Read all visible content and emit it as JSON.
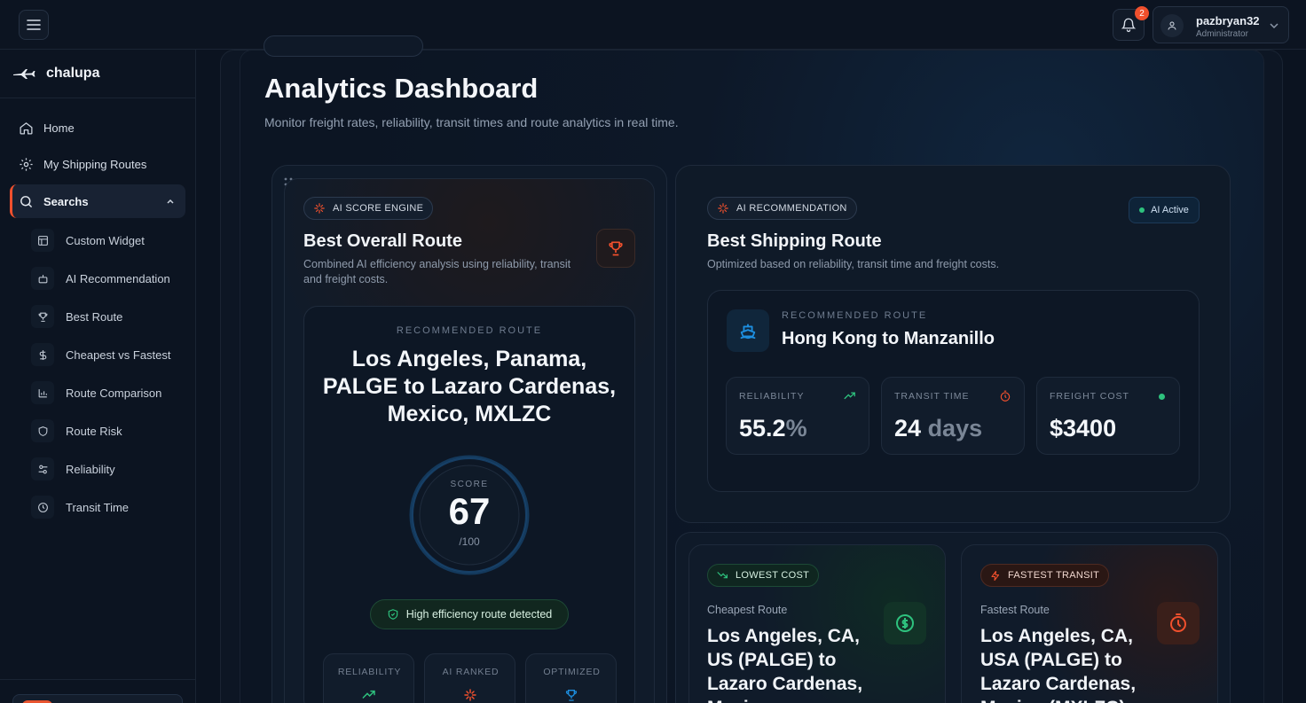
{
  "user": {
    "name": "pazbryan32",
    "role": "Administrator",
    "notifications": "2"
  },
  "brand": {
    "name": "chalupa"
  },
  "nav": {
    "home": "Home",
    "my_routes": "My Shipping Routes",
    "searchs": "Searchs",
    "sub": [
      "Custom Widget",
      "AI Recommendation",
      "Best Route",
      "Cheapest vs Fastest",
      "Route Comparison",
      "Route Risk",
      "Reliability",
      "Transit Time"
    ]
  },
  "page": {
    "title": "Analytics Dashboard",
    "subtitle": "Monitor freight rates, reliability, transit times and route analytics in real time."
  },
  "best_overall": {
    "tag": "AI SCORE ENGINE",
    "title": "Best Overall Route",
    "desc": "Combined AI efficiency analysis using reliability, transit and freight costs.",
    "rec_label": "RECOMMENDED ROUTE",
    "route": "Los Angeles, Panama, PALGE to Lazaro Cardenas, Mexico, MXLZC",
    "score_label": "SCORE",
    "score": 67,
    "score_max_label": "/100",
    "efficiency": "High efficiency route detected",
    "mini": [
      "RELIABILITY",
      "AI RANKED",
      "OPTIMIZED"
    ]
  },
  "best_shipping": {
    "tag": "AI RECOMMENDATION",
    "status": "AI Active",
    "title": "Best Shipping Route",
    "desc": "Optimized based on reliability, transit time and freight costs.",
    "rec_label": "RECOMMENDED ROUTE",
    "route": "Hong Kong to Manzanillo",
    "reliability_label": "RELIABILITY",
    "reliability_value": "55.2",
    "reliability_unit": "%",
    "transit_label": "TRANSIT TIME",
    "transit_value": "24",
    "transit_unit": "days",
    "cost_label": "FREIGHT COST",
    "cost_value": "$3400"
  },
  "cheapest": {
    "tag": "LOWEST COST",
    "sub": "Cheapest Route",
    "route": "Los Angeles, CA, US (PALGE) to Lazaro Cardenas, Mexico"
  },
  "fastest": {
    "tag": "FASTEST TRANSIT",
    "sub": "Fastest Route",
    "route": "Los Angeles, CA, USA (PALGE) to Lazaro Cardenas, Mexico (MXLZC)"
  },
  "colors": {
    "accent": "#f0502d",
    "green": "#2ec27e",
    "blue": "#1d8fe0"
  }
}
